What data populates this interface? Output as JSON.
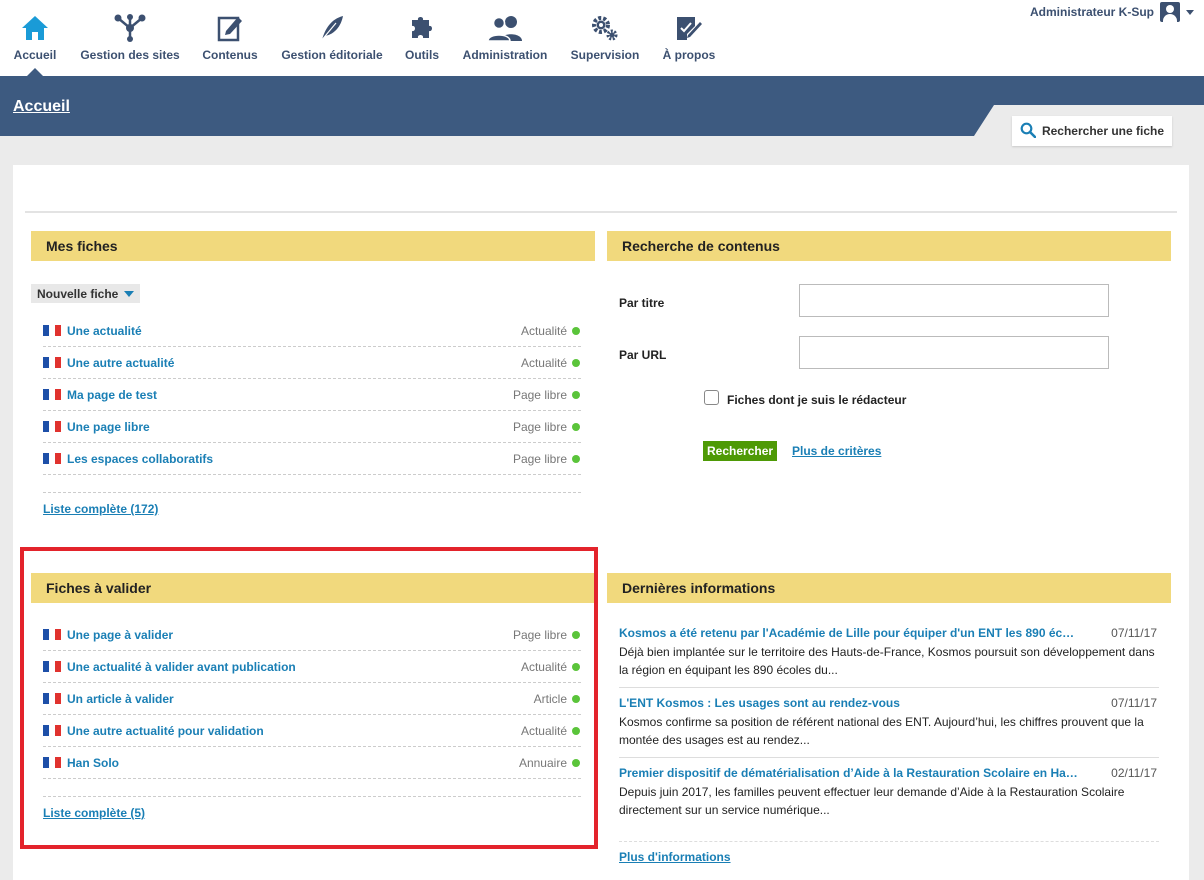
{
  "nav": {
    "items": [
      {
        "label": "Accueil",
        "icon": "home-icon"
      },
      {
        "label": "Gestion des sites",
        "icon": "sitemap-icon"
      },
      {
        "label": "Contenus",
        "icon": "edit-icon"
      },
      {
        "label": "Gestion éditoriale",
        "icon": "feather-icon"
      },
      {
        "label": "Outils",
        "icon": "puzzle-icon"
      },
      {
        "label": "Administration",
        "icon": "users-icon"
      },
      {
        "label": "Supervision",
        "icon": "gears-icon"
      },
      {
        "label": "À propos",
        "icon": "about-icon"
      }
    ],
    "user": "Administrateur K-Sup"
  },
  "header": {
    "title": "Accueil",
    "search_fiche": "Rechercher une fiche"
  },
  "colors": {
    "nav_text": "#3c5070",
    "band": "#3d5a80",
    "section_header": "#f1d97d",
    "link": "#1a7fb5",
    "status_online": "#5ac43a",
    "search_button": "#4e9a06",
    "highlight": "#e3232b"
  },
  "mes_fiches": {
    "title": "Mes fiches",
    "new_button": "Nouvelle fiche",
    "items": [
      {
        "title": "Une actualité",
        "type": "Actualité"
      },
      {
        "title": "Une autre actualité",
        "type": "Actualité"
      },
      {
        "title": "Ma page de test",
        "type": "Page libre"
      },
      {
        "title": "Une page libre",
        "type": "Page libre"
      },
      {
        "title": "Les espaces collaboratifs",
        "type": "Page libre"
      }
    ],
    "full_list": "Liste complète (172)"
  },
  "recherche": {
    "title": "Recherche de contenus",
    "par_titre": "Par titre",
    "par_url": "Par URL",
    "checkbox_label": "Fiches dont je suis le rédacteur",
    "search_button": "Rechercher",
    "more_criteria": "Plus de critères"
  },
  "fiches_a_valider": {
    "title": "Fiches à valider",
    "items": [
      {
        "title": "Une page à valider",
        "type": "Page libre"
      },
      {
        "title": "Une actualité à valider avant publication",
        "type": "Actualité"
      },
      {
        "title": "Un article à valider",
        "type": "Article"
      },
      {
        "title": "Une autre actualité pour validation",
        "type": "Actualité"
      },
      {
        "title": "Han Solo",
        "type": "Annuaire"
      }
    ],
    "full_list": "Liste complète (5)"
  },
  "dernieres_informations": {
    "title": "Dernières informations",
    "items": [
      {
        "title": "Kosmos a été retenu par l'Académie de Lille pour équiper d'un ENT les 890 éc…",
        "date": "07/11/17",
        "text": "Déjà bien implantée sur le territoire des Hauts-de-France, Kosmos poursuit son développement dans la région en équipant les 890 écoles du..."
      },
      {
        "title": "L'ENT Kosmos : Les usages sont au rendez-vous",
        "date": "07/11/17",
        "text": "Kosmos confirme sa position de référent national des ENT. Aujourd’hui, les chiffres prouvent que la montée des usages est au rendez..."
      },
      {
        "title": "Premier dispositif de dématérialisation d’Aide à la Restauration Scolaire en Ha…",
        "date": "02/11/17",
        "text": "Depuis juin 2017, les familles peuvent effectuer leur demande d’Aide à la Restauration Scolaire directement sur un service numérique..."
      }
    ],
    "more": "Plus d'informations"
  }
}
